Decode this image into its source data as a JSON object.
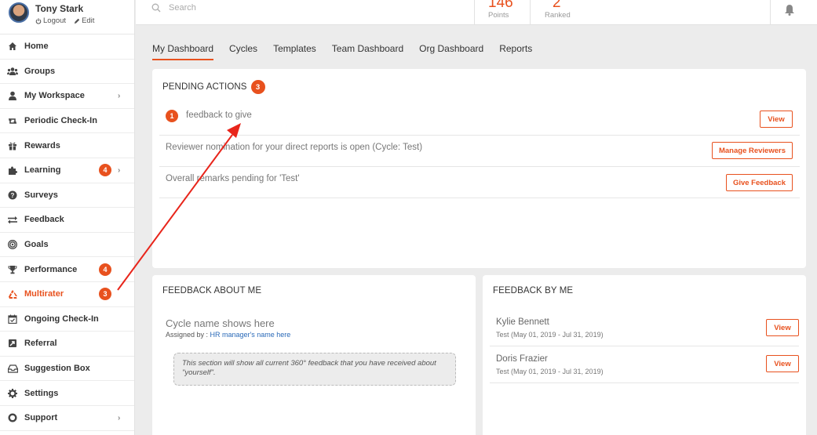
{
  "profile": {
    "name": "Tony Stark",
    "logout": "Logout",
    "edit": "Edit"
  },
  "sidebar": {
    "items": [
      {
        "label": "Home",
        "icon": "home-icon"
      },
      {
        "label": "Groups",
        "icon": "users-icon"
      },
      {
        "label": "My Workspace",
        "icon": "user-icon",
        "chevron": true
      },
      {
        "label": "Periodic Check-In",
        "icon": "retweet-icon"
      },
      {
        "label": "Rewards",
        "icon": "gift-icon"
      },
      {
        "label": "Learning",
        "icon": "puzzle-icon",
        "badge": "4",
        "chevron": true
      },
      {
        "label": "Surveys",
        "icon": "question-icon"
      },
      {
        "label": "Feedback",
        "icon": "exchange-icon"
      },
      {
        "label": "Goals",
        "icon": "target-icon"
      },
      {
        "label": "Performance",
        "icon": "trophy-icon",
        "badge": "4"
      },
      {
        "label": "Multirater",
        "icon": "recycle-icon",
        "badge": "3",
        "active": true
      },
      {
        "label": "Ongoing Check-In",
        "icon": "calendar-check-icon"
      },
      {
        "label": "Referral",
        "icon": "referral-icon"
      },
      {
        "label": "Suggestion Box",
        "icon": "inbox-icon"
      },
      {
        "label": "Settings",
        "icon": "gear-icon"
      },
      {
        "label": "Support",
        "icon": "lifebuoy-icon",
        "chevron": true
      }
    ]
  },
  "topbar": {
    "search_placeholder": "Search",
    "points_value": "146",
    "points_label": "Points",
    "ranked_value": "2",
    "ranked_label": "Ranked"
  },
  "tabs": [
    {
      "label": "My Dashboard",
      "active": true
    },
    {
      "label": "Cycles"
    },
    {
      "label": "Templates"
    },
    {
      "label": "Team Dashboard"
    },
    {
      "label": "Org Dashboard"
    },
    {
      "label": "Reports"
    }
  ],
  "pending": {
    "title": "PENDING ACTIONS",
    "count": "3",
    "rows": [
      {
        "badge": "1",
        "text": "feedback to give",
        "button": "View"
      },
      {
        "text": "Reviewer nomination for your direct reports is open (Cycle: Test)",
        "button": "Manage Reviewers"
      },
      {
        "text": "Overall remarks pending for 'Test'",
        "button": "Give Feedback"
      }
    ]
  },
  "about_me": {
    "title": "FEEDBACK ABOUT ME",
    "cycle_name": "Cycle name shows here",
    "assigned_prefix": "Assigned by : ",
    "assigned_by": "HR manager's name here",
    "note": "This section will show all current 360° feedback that you have received about \"yourself\"."
  },
  "by_me": {
    "title": "FEEDBACK BY ME",
    "rows": [
      {
        "name": "Kylie Bennett",
        "sub": "Test (May 01, 2019 - Jul 31, 2019)",
        "button": "View"
      },
      {
        "name": "Doris Frazier",
        "sub": "Test (May 01, 2019 - Jul 31, 2019)",
        "button": "View"
      }
    ]
  },
  "colors": {
    "accent": "#e8511e",
    "link": "#2a6ab8",
    "annotation_arrow": "#e8251b"
  }
}
